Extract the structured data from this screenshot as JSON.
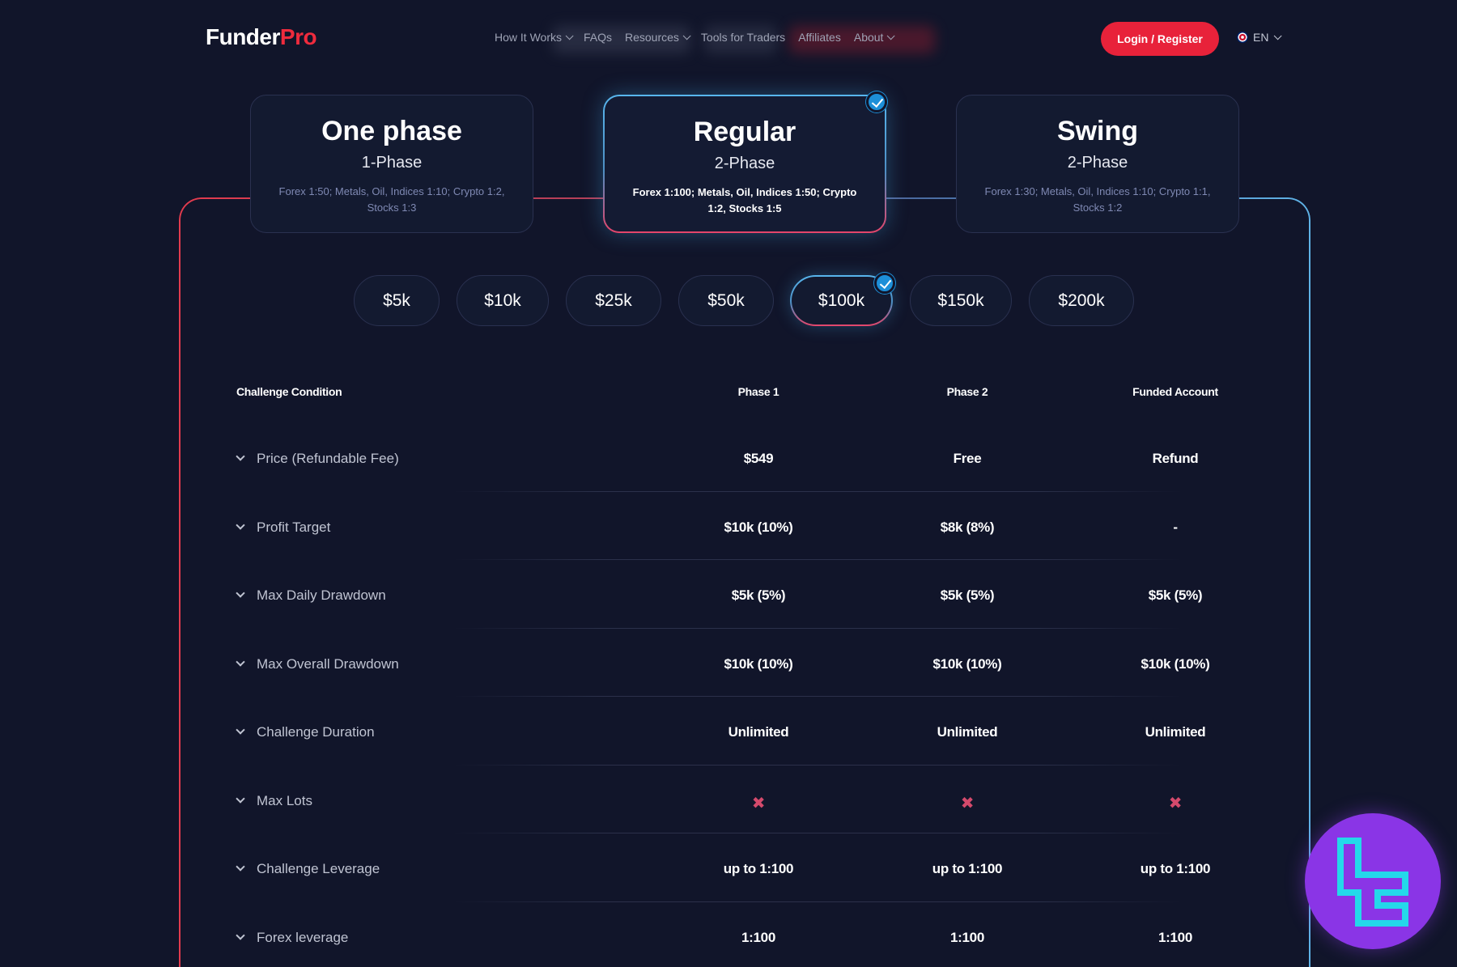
{
  "header": {
    "logo_left": "Funder",
    "logo_right": "Pro",
    "nav": [
      {
        "label": "How It Works",
        "dropdown": true
      },
      {
        "label": "FAQs",
        "dropdown": false
      },
      {
        "label": "Resources",
        "dropdown": true
      },
      {
        "label": "Tools for Traders",
        "dropdown": false
      },
      {
        "label": "Affiliates",
        "dropdown": false
      },
      {
        "label": "About",
        "dropdown": true
      }
    ],
    "login_label": "Login / Register",
    "language": "EN"
  },
  "plans": [
    {
      "title": "One phase",
      "subtitle": "1-Phase",
      "desc": "Forex 1:50; Metals, Oil, Indices 1:10; Crypto 1:2, Stocks 1:3",
      "selected": false
    },
    {
      "title": "Regular",
      "subtitle": "2-Phase",
      "desc": "Forex 1:100; Metals, Oil, Indices 1:50; Crypto 1:2, Stocks 1:5",
      "selected": true
    },
    {
      "title": "Swing",
      "subtitle": "2-Phase",
      "desc": "Forex 1:30; Metals, Oil, Indices 1:10; Crypto 1:1, Stocks 1:2",
      "selected": false
    }
  ],
  "sizes": [
    {
      "label": "$5k",
      "selected": false
    },
    {
      "label": "$10k",
      "selected": false
    },
    {
      "label": "$25k",
      "selected": false
    },
    {
      "label": "$50k",
      "selected": false
    },
    {
      "label": "$100k",
      "selected": true
    },
    {
      "label": "$150k",
      "selected": false
    },
    {
      "label": "$200k",
      "selected": false
    }
  ],
  "table": {
    "headers": [
      "Challenge Condition",
      "Phase 1",
      "Phase 2",
      "Funded Account"
    ],
    "rows": [
      {
        "label": "Price (Refundable Fee)",
        "values": [
          "$549",
          "Free",
          "Refund"
        ]
      },
      {
        "label": "Profit Target",
        "values": [
          "$10k (10%)",
          "$8k (8%)",
          "-"
        ]
      },
      {
        "label": "Max Daily Drawdown",
        "values": [
          "$5k (5%)",
          "$5k (5%)",
          "$5k (5%)"
        ]
      },
      {
        "label": "Max Overall Drawdown",
        "values": [
          "$10k (10%)",
          "$10k (10%)",
          "$10k (10%)"
        ]
      },
      {
        "label": "Challenge Duration",
        "values": [
          "Unlimited",
          "Unlimited",
          "Unlimited"
        ]
      },
      {
        "label": "Max Lots",
        "values": [
          "✖",
          "✖",
          "✖"
        ]
      },
      {
        "label": "Challenge Leverage",
        "values": [
          "up to 1:100",
          "up to 1:100",
          "up to 1:100"
        ]
      },
      {
        "label": "Forex leverage",
        "values": [
          "1:100",
          "1:100",
          "1:100"
        ]
      }
    ]
  },
  "colors": {
    "background": "#11152a",
    "accent_red": "#e8223a",
    "accent_blue": "#1d8fd8",
    "badge_purple": "#8a35e6"
  }
}
